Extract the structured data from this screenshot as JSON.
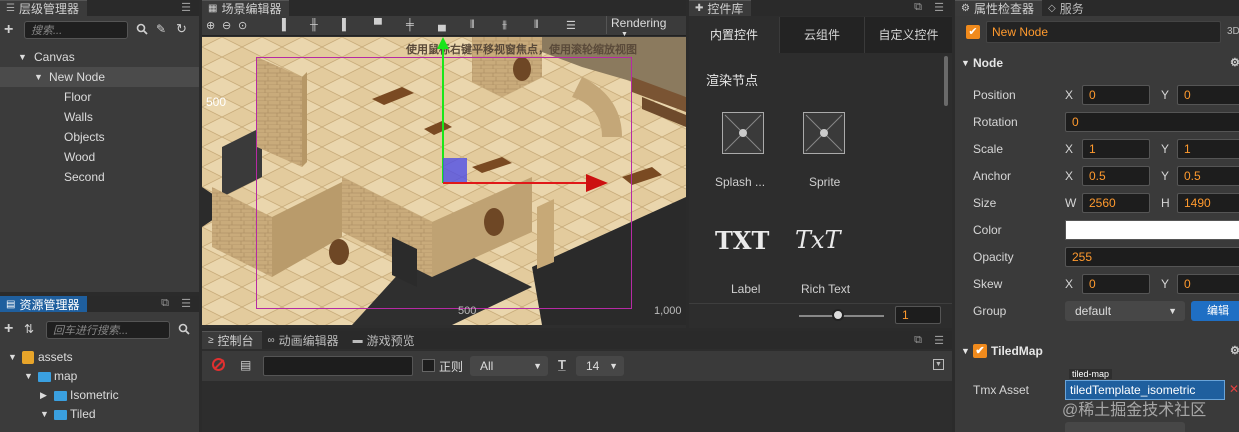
{
  "hierarchy": {
    "tab_label": "层级管理器",
    "search_placeholder": "搜索...",
    "nodes": [
      {
        "label": "Canvas"
      },
      {
        "label": "New Node"
      },
      {
        "label": "Floor"
      },
      {
        "label": "Walls"
      },
      {
        "label": "Objects"
      },
      {
        "label": "Wood"
      },
      {
        "label": "Second"
      }
    ]
  },
  "assets": {
    "tab_label": "资源管理器",
    "search_placeholder": "回车进行搜索...",
    "items": [
      {
        "label": "assets"
      },
      {
        "label": "map"
      },
      {
        "label": "Isometric"
      },
      {
        "label": "Tiled"
      }
    ]
  },
  "scene": {
    "tab_label": "场景编辑器",
    "rendering_label": "Rendering",
    "hint_text": "使用鼠标右键平移视窗焦点，使用滚轮缩放视图",
    "ruler_500": "500",
    "ruler_1000": "1,000",
    "ruler_500b": "500"
  },
  "widgets": {
    "tab_label": "控件库",
    "tabs": [
      "内置控件",
      "云组件",
      "自定义控件"
    ],
    "section_title": "渲染节点",
    "items": [
      {
        "label": "Splash ...",
        "icon": "sprite-splash-icon"
      },
      {
        "label": "Sprite",
        "icon": "sprite-icon"
      },
      {
        "label": "Label",
        "glyph": "TXT"
      },
      {
        "label": "Rich Text",
        "glyph": "TxT"
      }
    ],
    "zoom_value": "1"
  },
  "console": {
    "tabs": [
      "控制台",
      "动画编辑器",
      "游戏预览"
    ],
    "regex_label": "正则",
    "level_select": "All",
    "font_size": "14"
  },
  "inspector": {
    "tabs": [
      "属性检查器",
      "服务"
    ],
    "node_name": "New Node",
    "badge_3d": "3D",
    "node_section": "Node",
    "props": {
      "position": {
        "label": "Position",
        "x": "0",
        "y": "0"
      },
      "rotation": {
        "label": "Rotation",
        "value": "0"
      },
      "scale": {
        "label": "Scale",
        "x": "1",
        "y": "1"
      },
      "anchor": {
        "label": "Anchor",
        "x": "0.5",
        "y": "0.5"
      },
      "size": {
        "label": "Size",
        "w": "2560",
        "h": "1490"
      },
      "color": {
        "label": "Color",
        "value": "#ffffff"
      },
      "opacity": {
        "label": "Opacity",
        "value": "255"
      },
      "skew": {
        "label": "Skew",
        "x": "0",
        "y": "0"
      },
      "group": {
        "label": "Group",
        "value": "default",
        "edit_label": "编辑"
      }
    },
    "axis_x": "X",
    "axis_y": "Y",
    "axis_w": "W",
    "axis_h": "H",
    "tiledmap_section": "TiledMap",
    "tmx_label": "Tmx Asset",
    "tmx_tag": "tiled-map",
    "tmx_value": "tiledTemplate_isometric"
  },
  "watermark": "@稀土掘金技术社区",
  "colors": {
    "accent_blue": "#1f5f9e",
    "value_orange": "#ff9a2e",
    "check_orange": "#f08a1c"
  }
}
